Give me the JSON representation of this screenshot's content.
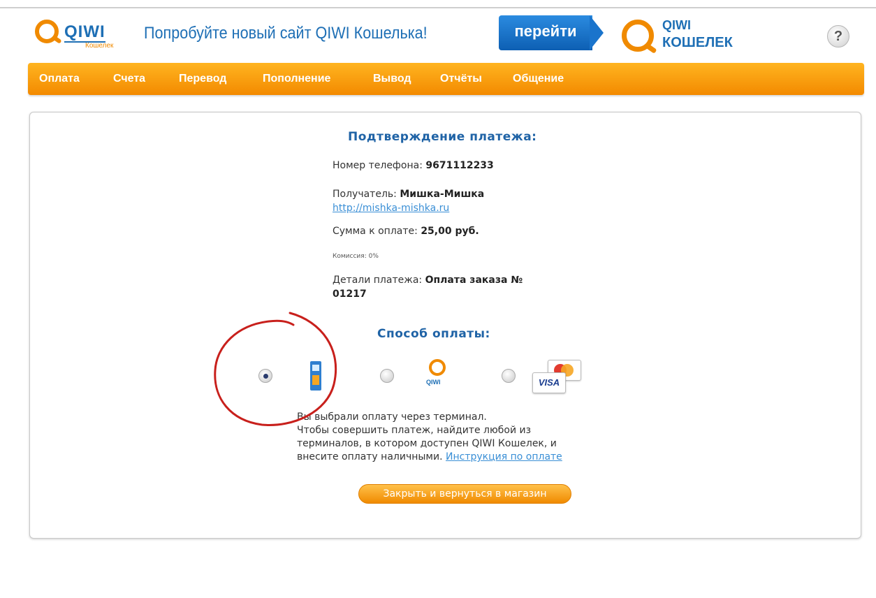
{
  "header": {
    "logo_text": "QIWI",
    "logo_sub": "Кошелек",
    "promo_text": "Попробуйте новый сайт QIWI Кошелька!",
    "go_button": "перейти",
    "logo2_line1": "QIWI",
    "logo2_line2": "КОШЕЛЕК",
    "help_label": "?"
  },
  "nav": {
    "items": [
      {
        "label": "Оплата"
      },
      {
        "label": "Счета"
      },
      {
        "label": "Перевод"
      },
      {
        "label": "Пополнение"
      },
      {
        "label": "Вывод"
      },
      {
        "label": "Отчёты"
      },
      {
        "label": "Общение"
      }
    ]
  },
  "confirm": {
    "title": "Подтверждение платежа:",
    "phone_label": "Номер телефона:",
    "phone_value": "9671112233",
    "recipient_label": "Получатель:",
    "recipient_value": "Мишка-Мишка",
    "recipient_link": "http://mishka-mishka.ru",
    "sum_label": "Сумма к оплате:",
    "sum_value": "25,00 руб.",
    "commission": "Комиссия: 0%",
    "details_label": "Детали платежа:",
    "details_value_line1": "Оплата заказа №",
    "details_value_line2": "01217"
  },
  "payment": {
    "title": "Способ оплаты:",
    "methods": [
      {
        "icon": "terminal-icon",
        "selected": true
      },
      {
        "icon": "qiwi-wallet-icon",
        "label": "QIWI",
        "selected": false
      },
      {
        "icon": "bank-card-icon",
        "label": "VISA",
        "selected": false
      }
    ],
    "info_line1": "Вы выбрали оплату через терминал.",
    "info_line2": "Чтобы совершить платеж, найдите любой из",
    "info_line3": "терминалов, в котором доступен QIWI Кошелек, и",
    "info_line4_text": "внесите оплату наличными.",
    "info_link": "Инструкция по оплате",
    "close_button": "Закрыть и вернуться в магазин"
  },
  "colors": {
    "brand_blue": "#1e6fb5",
    "brand_orange": "#f08a00",
    "annotation_red": "#c8201c"
  }
}
